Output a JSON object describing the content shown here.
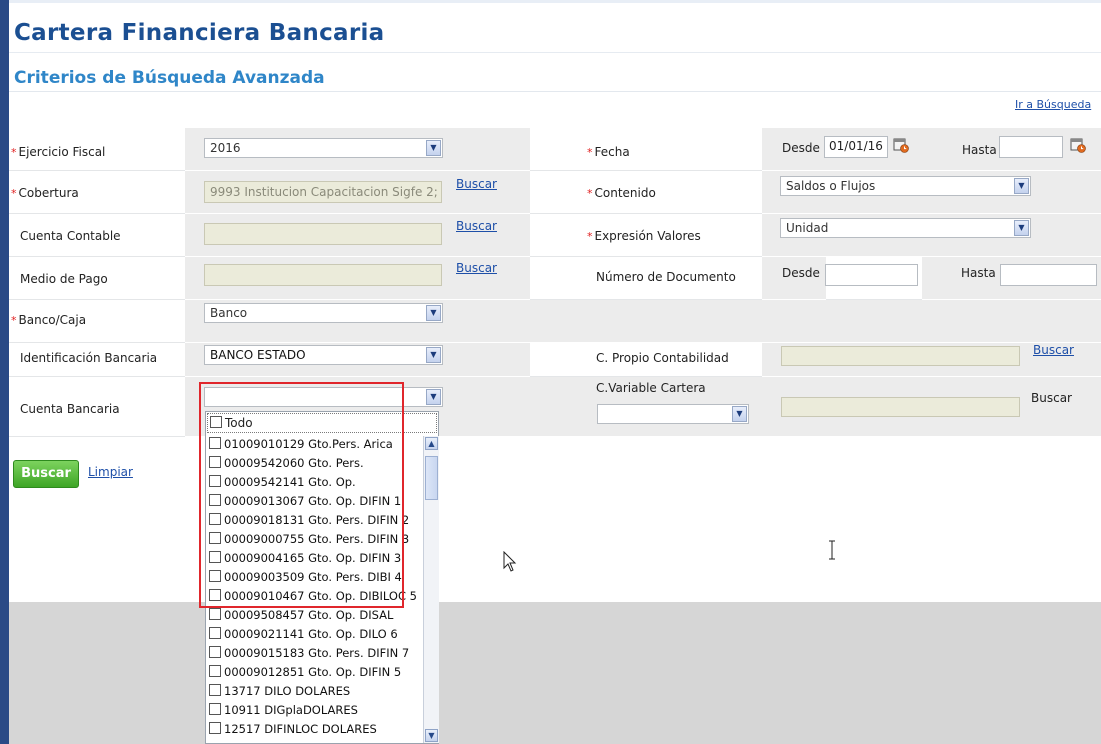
{
  "page": {
    "title": "Cartera Financiera Bancaria",
    "subtitle": "Criterios de Búsqueda Avanzada",
    "ir_busqueda_link": "Ir a Búsqueda"
  },
  "form": {
    "ejercicio_fiscal": {
      "label": "Ejercicio Fiscal",
      "value": "2016"
    },
    "cobertura": {
      "label": "Cobertura",
      "value": "9993 Institucion Capacitacion Sigfe 2;",
      "link": "Buscar"
    },
    "cuenta_contable": {
      "label": "Cuenta Contable",
      "value": "",
      "link": "Buscar"
    },
    "medio_pago": {
      "label": "Medio de Pago",
      "value": "",
      "link": "Buscar"
    },
    "banco_caja": {
      "label": "Banco/Caja",
      "value": "Banco"
    },
    "identificacion_bancaria": {
      "label": "Identificación Bancaria",
      "value": "BANCO ESTADO"
    },
    "cuenta_bancaria": {
      "label": "Cuenta Bancaria",
      "value": ""
    },
    "fecha": {
      "label": "Fecha",
      "desde_label": "Desde",
      "desde_value": "01/01/16",
      "hasta_label": "Hasta",
      "hasta_value": ""
    },
    "contenido": {
      "label": "Contenido",
      "value": "Saldos o Flujos"
    },
    "expresion_valores": {
      "label": "Expresión Valores",
      "value": "Unidad"
    },
    "numero_documento": {
      "label": "Número de Documento",
      "desde_label": "Desde",
      "hasta_label": "Hasta"
    },
    "c_propio_contabilidad": {
      "label": "C. Propio Contabilidad",
      "link": "Buscar"
    },
    "c_variable_cartera": {
      "label": "C.Variable Cartera",
      "link": "Buscar"
    },
    "required_marker": "*"
  },
  "actions": {
    "buscar": "Buscar",
    "limpiar": "Limpiar"
  },
  "dropdown": {
    "todo": "Todo",
    "items": [
      "01009010129 Gto.Pers. Arica",
      "00009542060 Gto. Pers.",
      "00009542141 Gto. Op.",
      "00009013067 Gto. Op. DIFIN 1",
      "00009018131 Gto. Pers. DIFIN 2",
      "00009000755 Gto. Pers. DIFIN 3",
      "00009004165 Gto. Op. DIFIN 3",
      "00009003509 Gto. Pers. DIBI 4",
      "00009010467 Gto. Op. DIBILOC 5",
      "00009508457 Gto. Op. DISAL",
      "00009021141 Gto. Op. DILO 6",
      "00009015183 Gto. Pers. DIFIN 7",
      "00009012851 Gto. Op. DIFIN 5",
      "13717 DILO DOLARES",
      "10911 DIGplaDOLARES",
      "12517 DIFINLOC DOLARES"
    ]
  },
  "colors": {
    "title": "#1b4f92",
    "subtitle": "#2f86c8",
    "highlight_box": "#e0262c",
    "buscar_button": "#3ea526"
  }
}
